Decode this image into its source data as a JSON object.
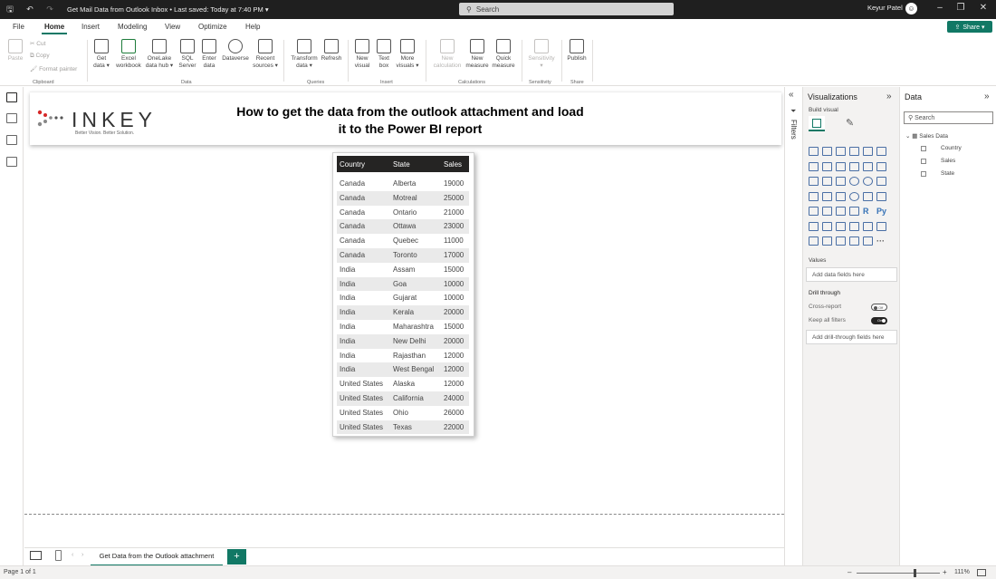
{
  "titlebar": {
    "title": "Get Mail Data from Outlook Inbox • Last saved: Today at 7:40 PM ▾",
    "search_placeholder": "Search",
    "user": "Keyur Patel"
  },
  "menu": {
    "tabs": [
      "File",
      "Home",
      "Insert",
      "Modeling",
      "View",
      "Optimize",
      "Help"
    ],
    "active": "Home",
    "share": "Share ▾"
  },
  "ribbon": {
    "clipboard": {
      "paste": "Paste",
      "cut": "Cut",
      "copy": "Copy",
      "format_painter": "Format painter",
      "label": "Clipboard"
    },
    "data": {
      "label": "Data",
      "buttons": [
        {
          "l1": "Get",
          "l2": "data ▾"
        },
        {
          "l1": "Excel",
          "l2": "workbook"
        },
        {
          "l1": "OneLake",
          "l2": "data hub ▾"
        },
        {
          "l1": "SQL",
          "l2": "Server"
        },
        {
          "l1": "Enter",
          "l2": "data"
        },
        {
          "l1": "Dataverse",
          "l2": ""
        },
        {
          "l1": "Recent",
          "l2": "sources ▾"
        }
      ]
    },
    "queries": {
      "label": "Queries",
      "buttons": [
        {
          "l1": "Transform",
          "l2": "data ▾"
        },
        {
          "l1": "Refresh",
          "l2": ""
        }
      ]
    },
    "insert": {
      "label": "Insert",
      "buttons": [
        {
          "l1": "New",
          "l2": "visual"
        },
        {
          "l1": "Text",
          "l2": "box"
        },
        {
          "l1": "More",
          "l2": "visuals ▾"
        }
      ]
    },
    "calculations": {
      "label": "Calculations",
      "buttons": [
        {
          "l1": "New",
          "l2": "calculation"
        },
        {
          "l1": "New",
          "l2": "measure"
        },
        {
          "l1": "Quick",
          "l2": "measure"
        }
      ]
    },
    "sensitivity": {
      "label": "Sensitivity",
      "buttons": [
        {
          "l1": "Sensitivity",
          "l2": "▾"
        }
      ]
    },
    "share": {
      "label": "Share",
      "buttons": [
        {
          "l1": "Publish",
          "l2": ""
        }
      ]
    }
  },
  "report": {
    "logo_text": "INKEY",
    "logo_tagline": "Better Vision. Better Solution.",
    "title_line1": "How to get the data from the outlook attachment and load",
    "title_line2": "it to the Power BI report"
  },
  "table": {
    "headers": [
      "Country",
      "State",
      "Sales"
    ],
    "rows": [
      [
        "Canada",
        "Alberta",
        "19000"
      ],
      [
        "Canada",
        "Motreal",
        "25000"
      ],
      [
        "Canada",
        "Ontario",
        "21000"
      ],
      [
        "Canada",
        "Ottawa",
        "23000"
      ],
      [
        "Canada",
        "Quebec",
        "11000"
      ],
      [
        "Canada",
        "Toronto",
        "17000"
      ],
      [
        "India",
        "Assam",
        "15000"
      ],
      [
        "India",
        "Goa",
        "10000"
      ],
      [
        "India",
        "Gujarat",
        "10000"
      ],
      [
        "India",
        "Kerala",
        "20000"
      ],
      [
        "India",
        "Maharashtra",
        "15000"
      ],
      [
        "India",
        "New Delhi",
        "20000"
      ],
      [
        "India",
        "Rajasthan",
        "12000"
      ],
      [
        "India",
        "West Bengal",
        "12000"
      ],
      [
        "United States",
        "Alaska",
        "12000"
      ],
      [
        "United States",
        "California",
        "24000"
      ],
      [
        "United States",
        "Ohio",
        "26000"
      ],
      [
        "United States",
        "Texas",
        "22000"
      ]
    ]
  },
  "filters": {
    "label": "Filters"
  },
  "visualizations": {
    "title": "Visualizations",
    "build_visual": "Build visual",
    "values_label": "Values",
    "values_placeholder": "Add data fields here",
    "drill_through": "Drill through",
    "cross_report": "Cross-report",
    "cross_report_state": "Off",
    "keep_all_filters": "Keep all filters",
    "keep_all_filters_state": "On",
    "drill_placeholder": "Add drill-through fields here",
    "r_label": "R",
    "py_label": "Py",
    "more_label": "···"
  },
  "data_pane": {
    "title": "Data",
    "search_placeholder": "Search",
    "table_name": "Sales Data",
    "fields": [
      "Country",
      "Sales",
      "State"
    ]
  },
  "pages": {
    "current": "Get Data from the Outlook attachment",
    "add": "+"
  },
  "status": {
    "page_info": "Page 1 of 1",
    "zoom": "111%"
  },
  "colors": {
    "accent": "#117865",
    "table_header": "#252423",
    "row_alt": "#eaeaea",
    "titlebar": "#1f1f1f"
  }
}
